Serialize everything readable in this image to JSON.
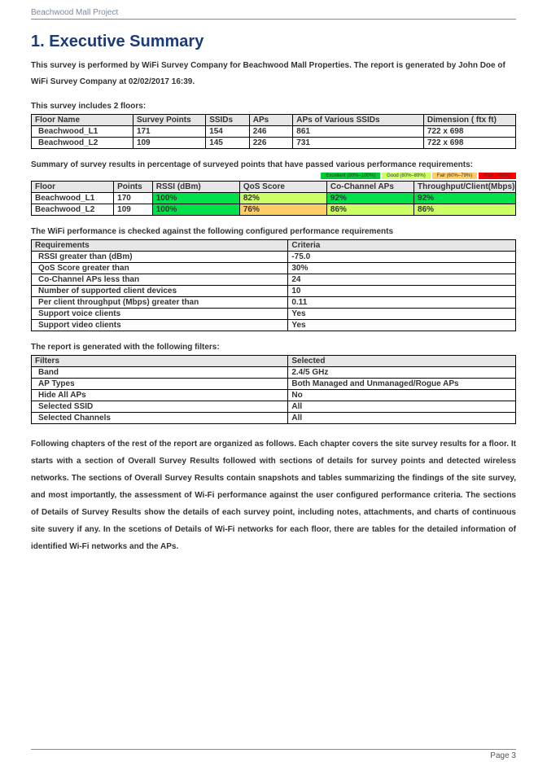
{
  "header": {
    "project": "Beachwood Mall Project"
  },
  "footer": {
    "page": "Page 3"
  },
  "title": "1. Executive Summary",
  "intro": "This survey is performed by WiFi Survey Company for Beachwood Mall Properties. The report is generated by John Doe of WiFi Survey Company at 02/02/2017 16:39.",
  "floors_label": "This survey includes 2 floors:",
  "floors_table": {
    "headers": [
      "Floor Name",
      "Survey Points",
      "SSIDs",
      "APs",
      "APs of Various SSIDs",
      "Dimension ( ftx ft)"
    ],
    "rows": [
      [
        "Beachwood_L1",
        "171",
        "154",
        "246",
        "861",
        "722 x 698"
      ],
      [
        "Beachwood_L2",
        "109",
        "145",
        "226",
        "731",
        "722 x 698"
      ]
    ]
  },
  "summary_label": "Summary of survey results in percentage of surveyed points that have passed various performance requirements:",
  "legend": {
    "excellent": "Excellent (90%–100%)",
    "good": "Good (80%–89%)",
    "fair": "Fair (60%–79%)",
    "poor": "Poor (<60%)"
  },
  "summary_table": {
    "headers": [
      "Floor",
      "Points",
      "RSSI (dBm)",
      "QoS Score",
      "Co-Channel APs",
      "Throughput/Client(Mbps)"
    ],
    "rows": [
      {
        "floor": "Beachwood_L1",
        "points": "170",
        "rssi": "100%",
        "qos": "82%",
        "cochan": "92%",
        "tput": "92%",
        "rssi_c": "c-green",
        "qos_c": "c-lgreen",
        "cochan_c": "c-green",
        "tput_c": "c-green"
      },
      {
        "floor": "Beachwood_L2",
        "points": "109",
        "rssi": "100%",
        "qos": "76%",
        "cochan": "86%",
        "tput": "86%",
        "rssi_c": "c-green",
        "qos_c": "c-orange",
        "cochan_c": "c-lgreen",
        "tput_c": "c-lgreen"
      }
    ]
  },
  "req_label": "The WiFi performance is checked against the following configured performance requirements",
  "req_table": {
    "headers": [
      "Requirements",
      "Criteria"
    ],
    "rows": [
      [
        "RSSI greater than (dBm)",
        "-75.0"
      ],
      [
        "QoS Score greater than",
        "30%"
      ],
      [
        "Co-Channel APs less than",
        "24"
      ],
      [
        "Number of supported client devices",
        "10"
      ],
      [
        "Per client throughput (Mbps) greater than",
        "0.11"
      ],
      [
        "Support voice clients",
        "Yes"
      ],
      [
        "Support video clients",
        "Yes"
      ]
    ]
  },
  "filters_label": "The report is generated with the following filters:",
  "filters_table": {
    "headers": [
      "Filters",
      "Selected"
    ],
    "rows": [
      [
        "Band",
        "2.4/5 GHz"
      ],
      [
        "AP Types",
        "Both Managed and Unmanaged/Rogue APs"
      ],
      [
        "Hide All APs",
        "No"
      ],
      [
        "Selected SSID",
        "All"
      ],
      [
        "Selected Channels",
        "All"
      ]
    ]
  },
  "closing": "Following chapters of the rest of the report are organized as follows. Each chapter covers the site survey results for a floor. It starts with a section of Overall Survey Results followed with sections of details for survey points and detected wireless networks. The sections of Overall Survey Results contain snapshots and tables summarizing the findings of the site survey, and most importantly, the assessment of Wi-Fi performance against the user configured performance criteria. The sections of Details of Survey Results show the details of each survey point, including notes, attachments, and charts of continuous site suvery if any. In the scetions of Details of Wi-Fi networks for each floor, there are tables for the detailed information of identified Wi-Fi networks and the APs."
}
